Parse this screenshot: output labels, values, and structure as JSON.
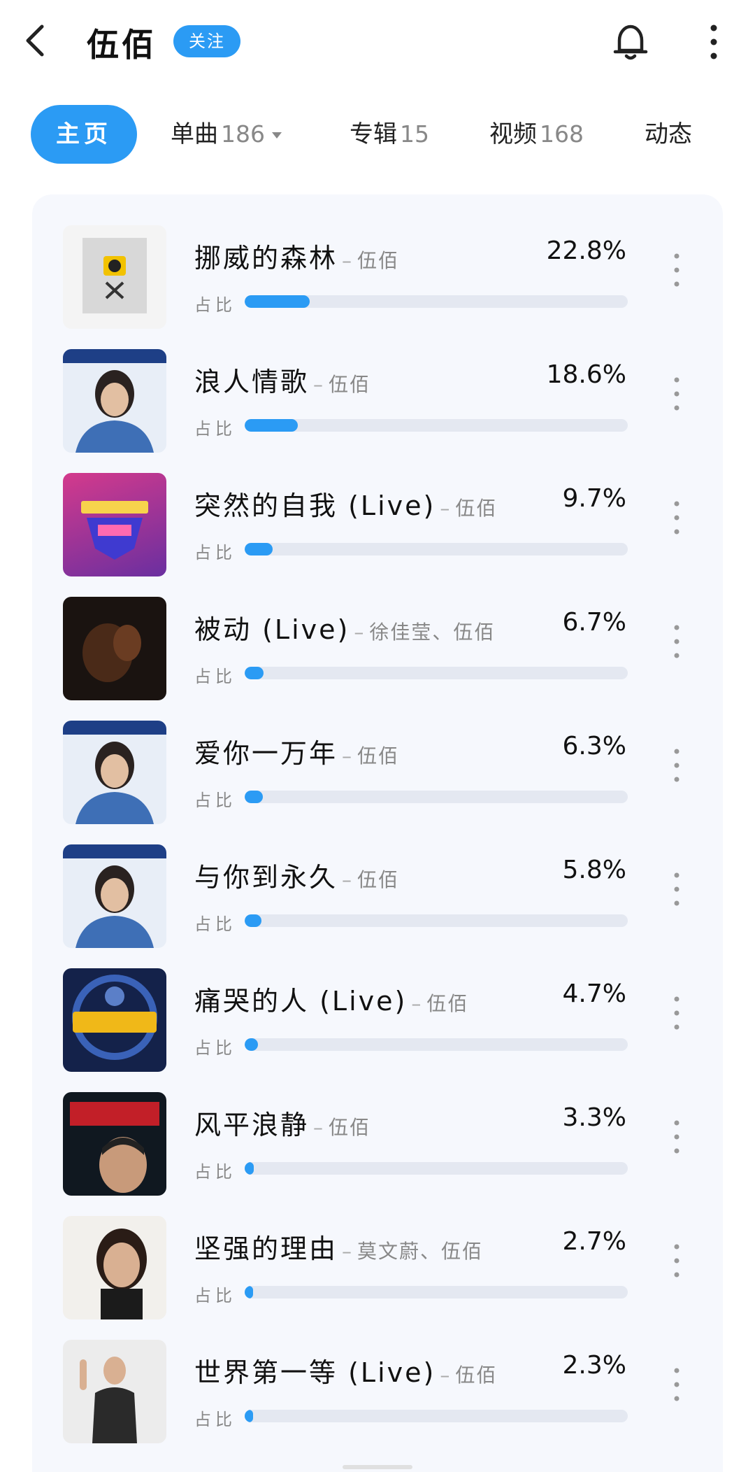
{
  "header": {
    "artist_name": "伍佰",
    "follow_label": "关注"
  },
  "tabs": [
    {
      "label": "主页",
      "count": ""
    },
    {
      "label": "单曲",
      "count": "186"
    },
    {
      "label": "专辑",
      "count": "15"
    },
    {
      "label": "视频",
      "count": "168"
    },
    {
      "label": "动态",
      "count": ""
    }
  ],
  "ratio_label": "占比",
  "songs": [
    {
      "title": "挪威的森林",
      "artists": "伍佰",
      "percent": "22.8%",
      "share": 0.228,
      "cover": "album-norwegian-wood"
    },
    {
      "title": "浪人情歌",
      "artists": "伍佰",
      "percent": "18.6%",
      "share": 0.186,
      "cover": "album-wubai-portrait"
    },
    {
      "title": "突然的自我 (Live)",
      "artists": "伍佰",
      "percent": "9.7%",
      "share": 0.097,
      "cover": "album-tv-show-purple"
    },
    {
      "title": "被动 (Live)",
      "artists": "徐佳莹、伍佰",
      "percent": "6.7%",
      "share": 0.067,
      "cover": "album-dark-live"
    },
    {
      "title": "爱你一万年",
      "artists": "伍佰",
      "percent": "6.3%",
      "share": 0.063,
      "cover": "album-wubai-portrait"
    },
    {
      "title": "与你到永久",
      "artists": "伍佰",
      "percent": "5.8%",
      "share": 0.058,
      "cover": "album-wubai-portrait"
    },
    {
      "title": "痛哭的人 (Live)",
      "artists": "伍佰",
      "percent": "4.7%",
      "share": 0.047,
      "cover": "album-compilation-blue"
    },
    {
      "title": "风平浪静",
      "artists": "伍佰",
      "percent": "3.3%",
      "share": 0.033,
      "cover": "album-calm-movie"
    },
    {
      "title": "坚强的理由",
      "artists": "莫文蔚、伍佰",
      "percent": "2.7%",
      "share": 0.027,
      "cover": "album-karen-mok"
    },
    {
      "title": "世界第一等 (Live)",
      "artists": "伍佰",
      "percent": "2.3%",
      "share": 0.023,
      "cover": "album-wubai-pointing"
    }
  ],
  "icons": {
    "back": "chevron-left-icon",
    "bell": "bell-icon",
    "more": "more-vertical-icon"
  },
  "colors": {
    "accent": "#2b9bf4",
    "track": "#e4e8f1",
    "card_bg": "#f6f8fd"
  }
}
